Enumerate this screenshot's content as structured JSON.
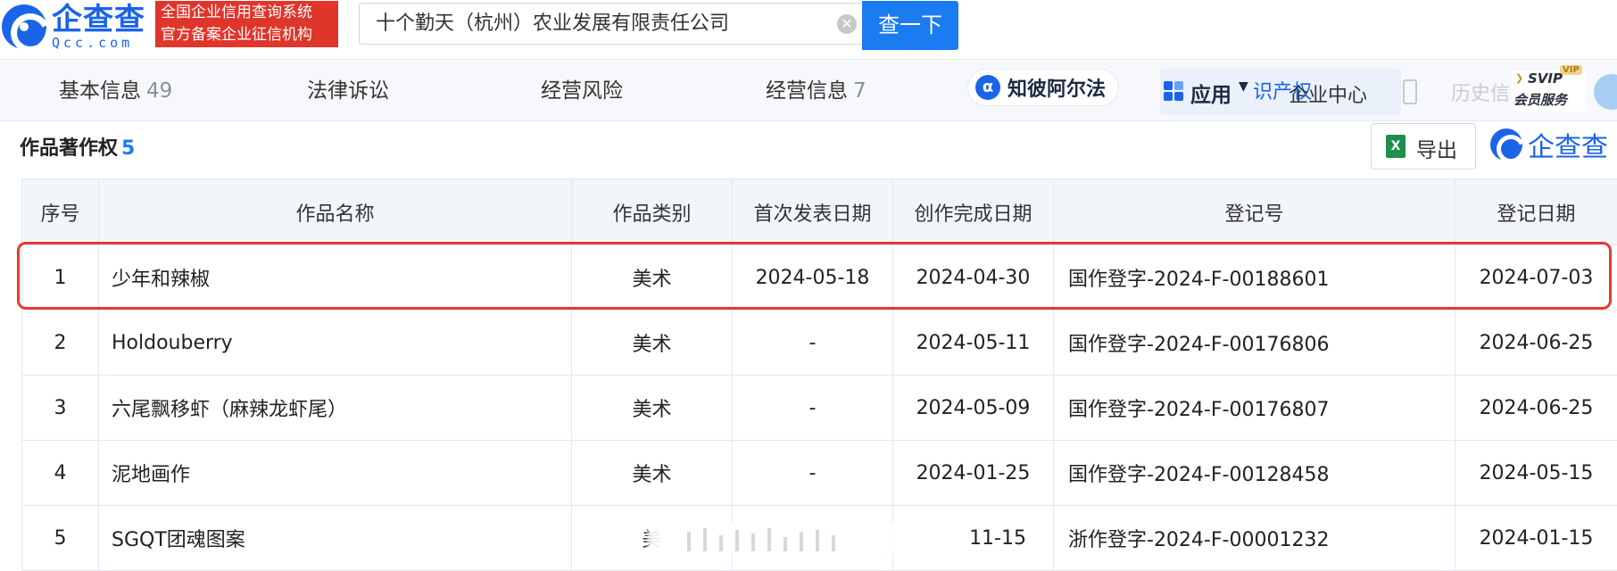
{
  "header": {
    "logo_cn": "企查查",
    "logo_en": "Qcc.com",
    "badge_line1": "全国企业信用查询系统",
    "badge_line2": "官方备案企业征信机构",
    "search_value": "十个勤天（杭州）农业发展有限责任公司",
    "search_button": "查一下"
  },
  "nav": {
    "items": [
      {
        "label": "基本信息",
        "count": "49"
      },
      {
        "label": "法律诉讼",
        "count": ""
      },
      {
        "label": "经营风险",
        "count": ""
      },
      {
        "label": "经营信息",
        "count": "7"
      }
    ],
    "zhibi": "知彼阿尔法",
    "apps": "应用",
    "apps_overlap1": "识产权",
    "apps_overlap2": "企业中心",
    "history": "历史信",
    "svip_top": "SVIP",
    "svip_bottom": "会员服务",
    "svip_badge": "VIP"
  },
  "section": {
    "title": "作品著作权",
    "count": "5",
    "export": "导出",
    "brand": "企查查"
  },
  "table": {
    "columns": [
      "序号",
      "作品名称",
      "作品类别",
      "首次发表日期",
      "创作完成日期",
      "登记号",
      "登记日期"
    ],
    "rows": [
      [
        "1",
        "少年和辣椒",
        "美术",
        "2024-05-18",
        "2024-04-30",
        "国作登字-2024-F-00188601",
        "2024-07-03"
      ],
      [
        "2",
        "Holdouberry",
        "美术",
        "-",
        "2024-05-11",
        "国作登字-2024-F-00176806",
        "2024-06-25"
      ],
      [
        "3",
        "六尾飘移虾（麻辣龙虾尾）",
        "美术",
        "-",
        "2024-05-09",
        "国作登字-2024-F-00176807",
        "2024-06-25"
      ],
      [
        "4",
        "泥地画作",
        "美术",
        "-",
        "2024-01-25",
        "国作登字-2024-F-00128458",
        "2024-05-15"
      ],
      [
        "5",
        "SGQT团魂图案",
        "美",
        "",
        "11-15",
        "浙作登字-2024-F-00001232",
        "2024-01-15"
      ]
    ]
  }
}
